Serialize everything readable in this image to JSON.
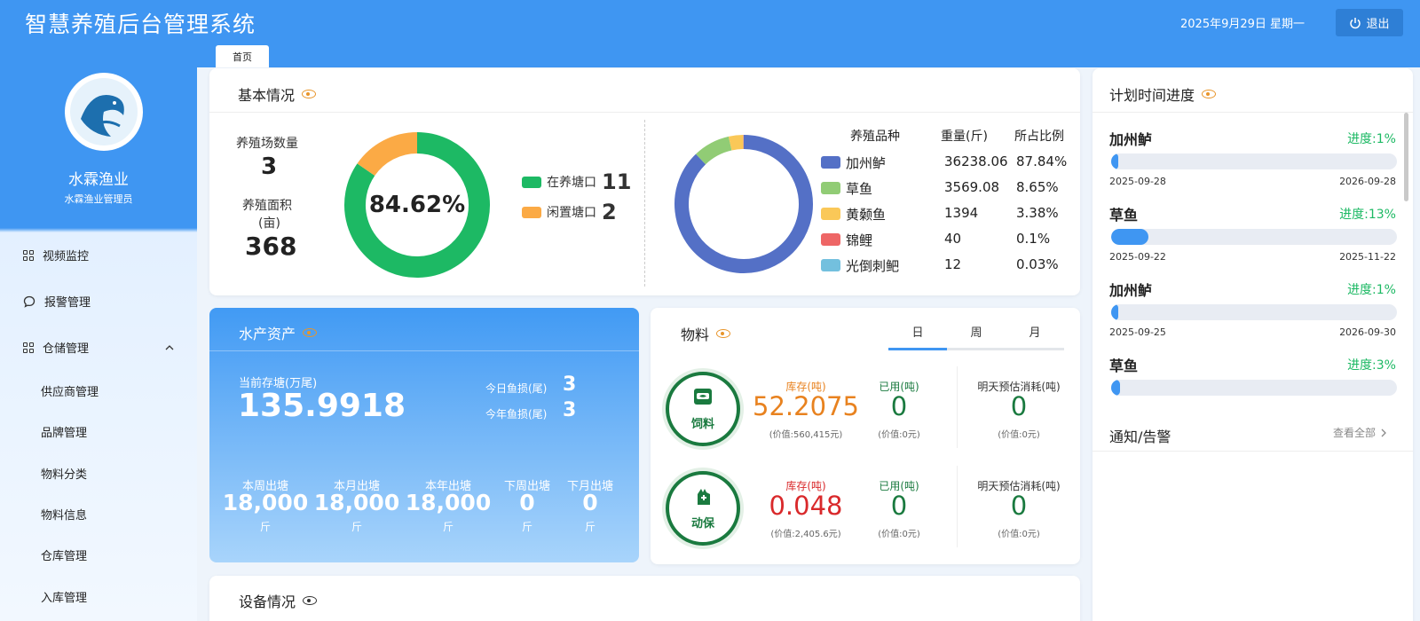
{
  "header": {
    "title": "智慧养殖后台管理系统",
    "date": "2025年9月29日 星期一",
    "logout_label": "退出"
  },
  "sidebar": {
    "company": "水霖渔业",
    "role": "水霖渔业管理员",
    "items": [
      {
        "label": "视频监控"
      },
      {
        "label": "报警管理"
      },
      {
        "label": "仓储管理"
      }
    ],
    "sub_items": [
      {
        "label": "供应商管理"
      },
      {
        "label": "品牌管理"
      },
      {
        "label": "物料分类"
      },
      {
        "label": "物料信息"
      },
      {
        "label": "仓库管理"
      },
      {
        "label": "入库管理"
      }
    ]
  },
  "tabs": [
    {
      "label": "首页"
    }
  ],
  "basic": {
    "title": "基本情况",
    "farm_count_label": "养殖场数量",
    "farm_count": "3",
    "area_label": "养殖面积",
    "area_unit": "(亩)",
    "area": "368",
    "donut_percent": "84.62%",
    "active_label": "在养塘口",
    "active_count": "11",
    "idle_label": "闲置塘口",
    "idle_count": "2",
    "active_value": 11,
    "idle_value": 2,
    "active_color": "#1db964",
    "idle_color": "#fbaa45",
    "species_header": {
      "name": "养殖品种",
      "weight": "重量(斤)",
      "ratio": "所占比例"
    },
    "species": [
      {
        "name": "加州鲈",
        "weight": "36238.06",
        "ratio": "87.84%",
        "value": 87.84,
        "color": "#5470c6"
      },
      {
        "name": "草鱼",
        "weight": "3569.08",
        "ratio": "8.65%",
        "value": 8.65,
        "color": "#91cc75"
      },
      {
        "name": "黄颡鱼",
        "weight": "1394",
        "ratio": "3.38%",
        "value": 3.38,
        "color": "#fac858"
      },
      {
        "name": "锦鲤",
        "weight": "40",
        "ratio": "0.1%",
        "value": 0.1,
        "color": "#ee6666"
      },
      {
        "name": "光倒刺鲃",
        "weight": "12",
        "ratio": "0.03%",
        "value": 0.03,
        "color": "#73c0de"
      }
    ]
  },
  "assets": {
    "title": "水产资产",
    "stock_label": "当前存塘(万尾)",
    "stock": "135.9918",
    "today_loss_label": "今日鱼损(尾)",
    "today_loss": "3",
    "year_loss_label": "今年鱼损(尾)",
    "year_loss": "3",
    "shipments": [
      {
        "label": "本周出塘",
        "value": "18,000",
        "unit": "斤"
      },
      {
        "label": "本月出塘",
        "value": "18,000",
        "unit": "斤"
      },
      {
        "label": "本年出塘",
        "value": "18,000",
        "unit": "斤"
      },
      {
        "label": "下周出塘",
        "value": "0",
        "unit": "斤"
      },
      {
        "label": "下月出塘",
        "value": "0",
        "unit": "斤"
      }
    ]
  },
  "materials": {
    "title": "物料",
    "tabs": [
      "日",
      "周",
      "月"
    ],
    "feed": {
      "name": "饲料",
      "stock_label": "库存(吨)",
      "stock": "52.2075",
      "stock_value": "(价值:560,415元)",
      "used_label": "已用(吨)",
      "used": "0",
      "used_value": "(价值:0元)",
      "forecast_label": "明天预估消耗(吨)",
      "forecast": "0",
      "forecast_value": "(价值:0元)"
    },
    "protect": {
      "name": "动保",
      "stock_label": "库存(吨)",
      "stock": "0.048",
      "stock_value": "(价值:2,405.6元)",
      "used_label": "已用(吨)",
      "used": "0",
      "used_value": "(价值:0元)",
      "forecast_label": "明天预估消耗(吨)",
      "forecast": "0",
      "forecast_value": "(价值:0元)"
    }
  },
  "equipment": {
    "title": "设备情况"
  },
  "plan": {
    "title": "计划时间进度",
    "items": [
      {
        "name": "加州鲈",
        "progress_label": "进度:1%",
        "progress": 1,
        "start": "2025-09-28",
        "end": "2026-09-28"
      },
      {
        "name": "草鱼",
        "progress_label": "进度:13%",
        "progress": 13,
        "start": "2025-09-22",
        "end": "2025-11-22"
      },
      {
        "name": "加州鲈",
        "progress_label": "进度:1%",
        "progress": 1,
        "start": "2025-09-25",
        "end": "2026-09-30"
      },
      {
        "name": "草鱼",
        "progress_label": "进度:3%",
        "progress": 3,
        "start": "",
        "end": ""
      }
    ]
  },
  "notice": {
    "title": "通知/告警",
    "view_all": "查看全部"
  },
  "colors": {
    "primary": "#3f96f2",
    "progress_green": "#1db964",
    "feed_orange": "#e8821f",
    "protect_red": "#d9292b",
    "used_green": "#1a7a3f"
  }
}
